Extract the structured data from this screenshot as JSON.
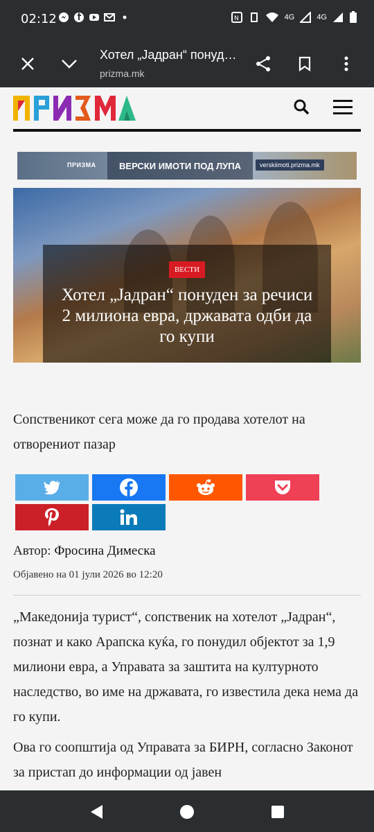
{
  "status_bar": {
    "time": "02:12",
    "notifications": [
      "messenger-icon",
      "facebook-icon",
      "youtube-icon",
      "gmail-icon",
      "dot-icon"
    ],
    "network_label_1": "4G",
    "network_label_2": "4G"
  },
  "browser": {
    "page_title": "Хотел „Јадран“ понуден за речиси 2 милиона евра, државата одби да го купи",
    "url": "prizma.mk"
  },
  "site": {
    "logo_text": "ПРИЗМА",
    "logo_colors": [
      "#f0b400",
      "#e0283a",
      "#2aa0d8",
      "#8b2bb3",
      "#2eb88a",
      "#e25a1c"
    ]
  },
  "banner": {
    "logo": "ПРИЗМА",
    "text": "ВЕРСКИ ИМОТИ ПОД ЛУПА",
    "url": "verskiimoti.prizma.mk"
  },
  "article": {
    "category": "ВЕСТИ",
    "title": "Хотел „Јадран“ понуден за речиси 2 милиона евра, државата одби да го купи",
    "subtitle": "Сопственикот сега може да го продава хотелот на отворениот пазар",
    "author_label": "Автор:",
    "author_name": "Фросина Димеска",
    "published": "Објавено на 01 јули 2026 во 12:20",
    "paragraphs": [
      "„Македонија турист“, сопственик на хотелот „Јадран“, познат и како Арапска куќа, го понудил објектот за 1,9 милиони евра, а Управата за заштита на културното наследство, во име на државата, го известила дека нема да го купи.",
      "Ова го соопштија од Управата за БИРН, согласно Законот за пристап до информации од јавен"
    ]
  },
  "share_buttons": [
    {
      "name": "twitter",
      "color": "#5aaee8"
    },
    {
      "name": "facebook",
      "color": "#1877f2"
    },
    {
      "name": "reddit",
      "color": "#ff5700"
    },
    {
      "name": "pocket",
      "color": "#ef4056"
    },
    {
      "name": "pinterest",
      "color": "#cb2027"
    },
    {
      "name": "linkedin",
      "color": "#0a7bb8"
    }
  ]
}
